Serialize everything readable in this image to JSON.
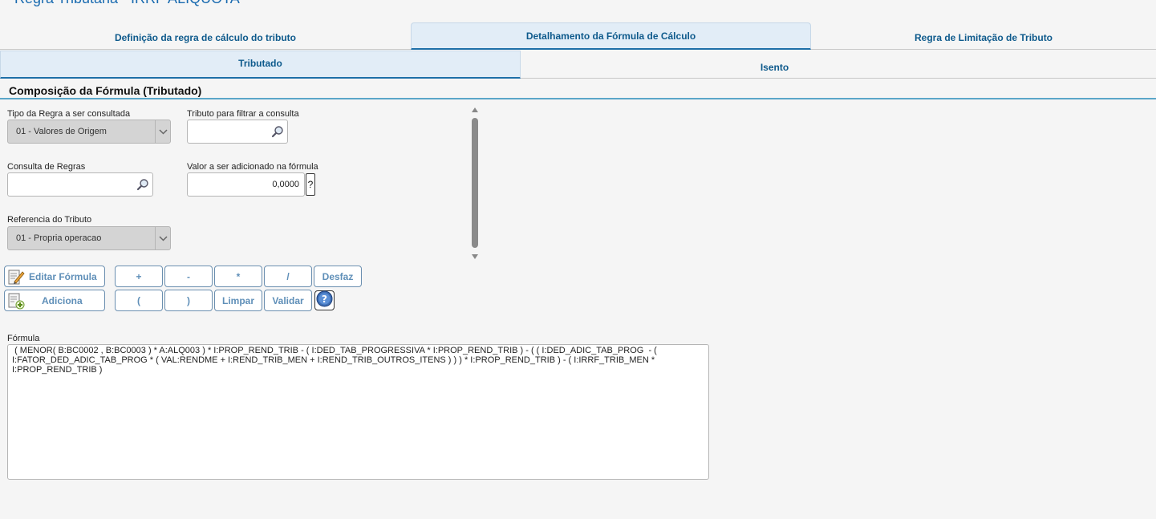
{
  "page": {
    "title": "Regra Tributária - IRRF ALÍQUOTA"
  },
  "main_tabs": [
    {
      "label": "Definição da regra de cálculo do tributo"
    },
    {
      "label": "Detalhamento da Fórmula de Cálculo"
    },
    {
      "label": "Regra de Limitação de Tributo"
    }
  ],
  "sub_tabs": [
    {
      "label": "Tributado"
    },
    {
      "label": "Isento"
    }
  ],
  "section": {
    "title": "Composição da Fórmula (Tributado)"
  },
  "fields": {
    "tipo_regra": {
      "label": "Tipo da Regra a ser consultada",
      "value": "01 - Valores de Origem"
    },
    "tributo_filtro": {
      "label": "Tributo para filtrar a consulta",
      "value": ""
    },
    "consulta_regras": {
      "label": "Consulta de Regras",
      "value": ""
    },
    "valor_adicionado": {
      "label": "Valor a ser adicionado na fórmula",
      "value": "0,0000",
      "help": "?"
    },
    "referencia_tributo": {
      "label": "Referencia do Tributo",
      "value": "01 - Propria operacao"
    }
  },
  "buttons": {
    "editar_formula": "Editar Fórmula",
    "adiciona": "Adiciona",
    "plus": "+",
    "minus": "-",
    "times": "*",
    "divide": "/",
    "desfaz": "Desfaz",
    "open_paren": "(",
    "close_paren": ")",
    "limpar": "Limpar",
    "validar": "Validar"
  },
  "formula": {
    "label": "Fórmula",
    "value": " ( MENOR( B:BC0002 , B:BC0003 ) * A:ALQ003 ) * I:PROP_REND_TRIB - ( I:DED_TAB_PROGRESSIVA * I:PROP_REND_TRIB ) - ( ( I:DED_ADIC_TAB_PROG  - (\nI:FATOR_DED_ADIC_TAB_PROG * ( VAL:RENDME + I:REND_TRIB_MEN + I:REND_TRIB_OUTROS_ITENS ) ) ) * I:PROP_REND_TRIB ) - ( I:IRRF_TRIB_MEN *\nI:PROP_REND_TRIB )"
  },
  "colors": {
    "accent": "#1e6fa8",
    "tab_text": "#0e5a8c",
    "button_text": "#5f8fb8"
  }
}
